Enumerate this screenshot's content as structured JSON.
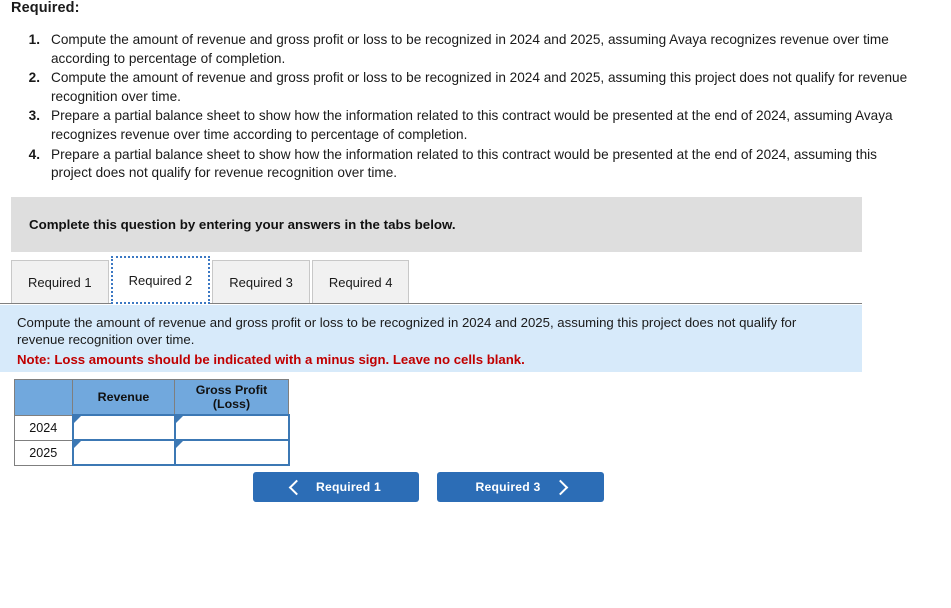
{
  "heading": "Required:",
  "requirements": [
    {
      "num": "1.",
      "text": "Compute the amount of revenue and gross profit or loss to be recognized in 2024 and 2025, assuming Avaya recognizes revenue over time according to percentage of completion."
    },
    {
      "num": "2.",
      "text": "Compute the amount of revenue and gross profit or loss to be recognized in 2024 and 2025, assuming this project does not qualify for revenue recognition over time."
    },
    {
      "num": "3.",
      "text": "Prepare a partial balance sheet to show how the information related to this contract would be presented at the end of 2024, assuming Avaya recognizes revenue over time according to percentage of completion."
    },
    {
      "num": "4.",
      "text": "Prepare a partial balance sheet to show how the information related to this contract would be presented at the end of 2024, assuming this project does not qualify for revenue recognition over time."
    }
  ],
  "banner": {
    "text": "Complete this question by entering your answers in the tabs below."
  },
  "tabs": [
    {
      "label": "Required 1",
      "active": false
    },
    {
      "label": "Required 2",
      "active": true
    },
    {
      "label": "Required 3",
      "active": false
    },
    {
      "label": "Required 4",
      "active": false
    }
  ],
  "question": {
    "prompt": "Compute the amount of revenue and gross profit or loss to be recognized in 2024 and 2025, assuming this project does not qualify for revenue recognition over time.",
    "note": "Note: Loss amounts should be indicated with a minus sign. Leave no cells blank."
  },
  "table": {
    "headers": [
      "",
      "Revenue",
      "Gross Profit (Loss)"
    ],
    "header_gross_line1": "Gross Profit",
    "header_gross_line2": "(Loss)",
    "rows": [
      {
        "label": "2024",
        "revenue": "",
        "gross_profit": ""
      },
      {
        "label": "2025",
        "revenue": "",
        "gross_profit": ""
      }
    ]
  },
  "nav": {
    "prev_label": "Required 1",
    "next_label": "Required 3",
    "prev_icon": "chevron-left-icon",
    "next_icon": "chevron-right-icon"
  },
  "colors": {
    "table_header_blue": "#71a8dd",
    "input_border_blue": "#3c78b4",
    "question_box_blue": "#d7eafa",
    "banner_gray": "#dedede",
    "button_blue": "#2c6db6",
    "note_red": "#c00000",
    "active_tab_border": "#3b78c3"
  }
}
